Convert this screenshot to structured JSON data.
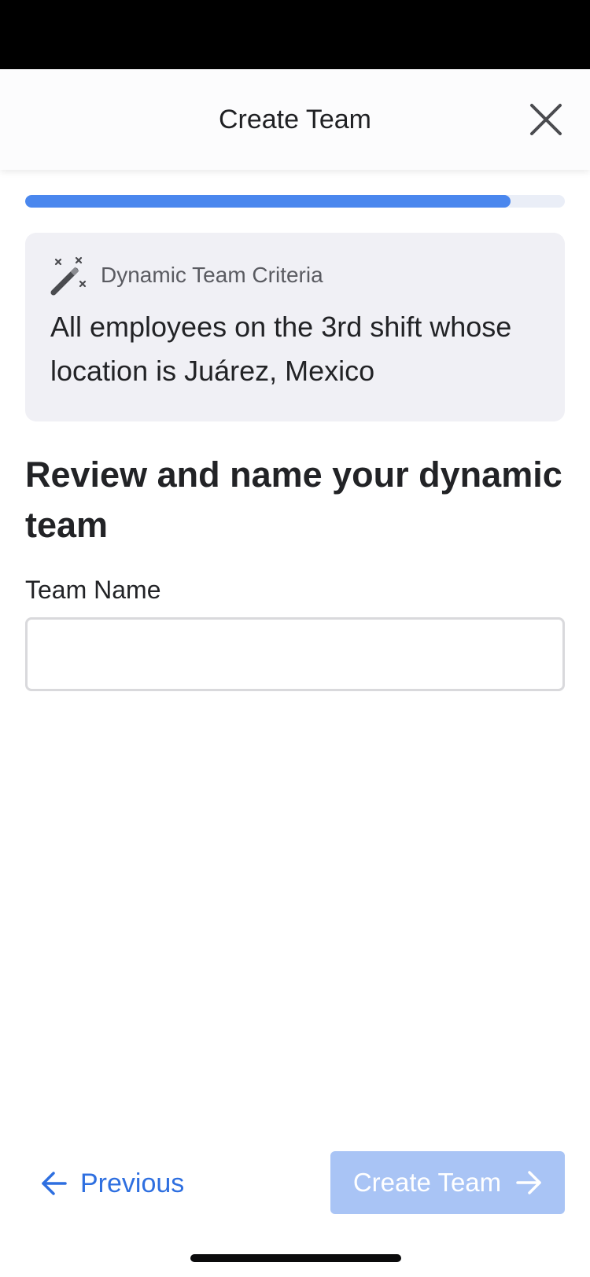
{
  "header": {
    "title": "Create Team",
    "close_icon": "close-icon"
  },
  "progress": {
    "value": 0.9
  },
  "criteria_card": {
    "icon": "magic-wand-icon",
    "label": "Dynamic Team Criteria",
    "text": "All employees on the 3rd shift whose location is Juárez, Mexico"
  },
  "main": {
    "heading": "Review and name your dynamic team",
    "team_name_label": "Team Name",
    "team_name_value": "",
    "team_name_placeholder": ""
  },
  "footer": {
    "previous_label": "Previous",
    "previous_icon": "arrow-left-icon",
    "create_label": "Create Team",
    "create_icon": "arrow-right-icon",
    "create_enabled": false
  },
  "colors": {
    "accent": "#4a87ee",
    "link": "#2e6fe0",
    "disabled_button": "#a9c4f5",
    "card_background": "#f0f0f5",
    "progress_track": "#eaeef7"
  }
}
